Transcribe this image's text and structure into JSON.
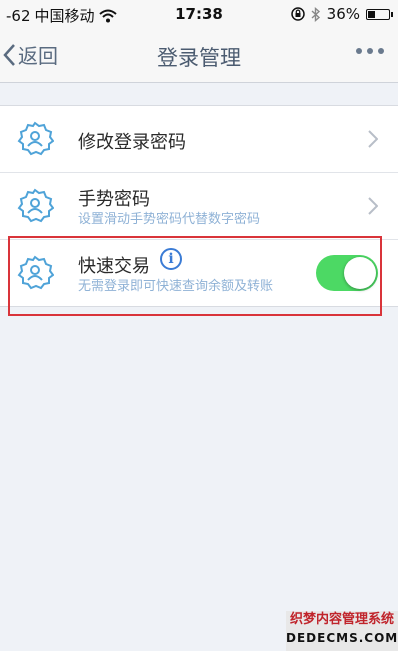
{
  "status_bar": {
    "signal": "-62",
    "carrier": "中国移动",
    "time": "17:38",
    "battery": "36%",
    "battery_level": 0.36
  },
  "nav": {
    "back_label": "返回",
    "title": "登录管理"
  },
  "settings": [
    {
      "title": "修改登录密码",
      "subtitle": ""
    },
    {
      "title": "手势密码",
      "subtitle": "设置滑动手势密码代替数字密码"
    },
    {
      "title": "快速交易",
      "subtitle": "无需登录即可快速查询余额及转账",
      "toggle_on": true
    }
  ],
  "info_icon_text": "i",
  "watermark": {
    "line1": "织梦内容管理系统",
    "line2": "DEDECMS.COM"
  },
  "colors": {
    "accent": "#4cd964",
    "icon": "#4fa3d8",
    "highlight": "#d9343a",
    "subtitle": "#8fb2d6"
  }
}
